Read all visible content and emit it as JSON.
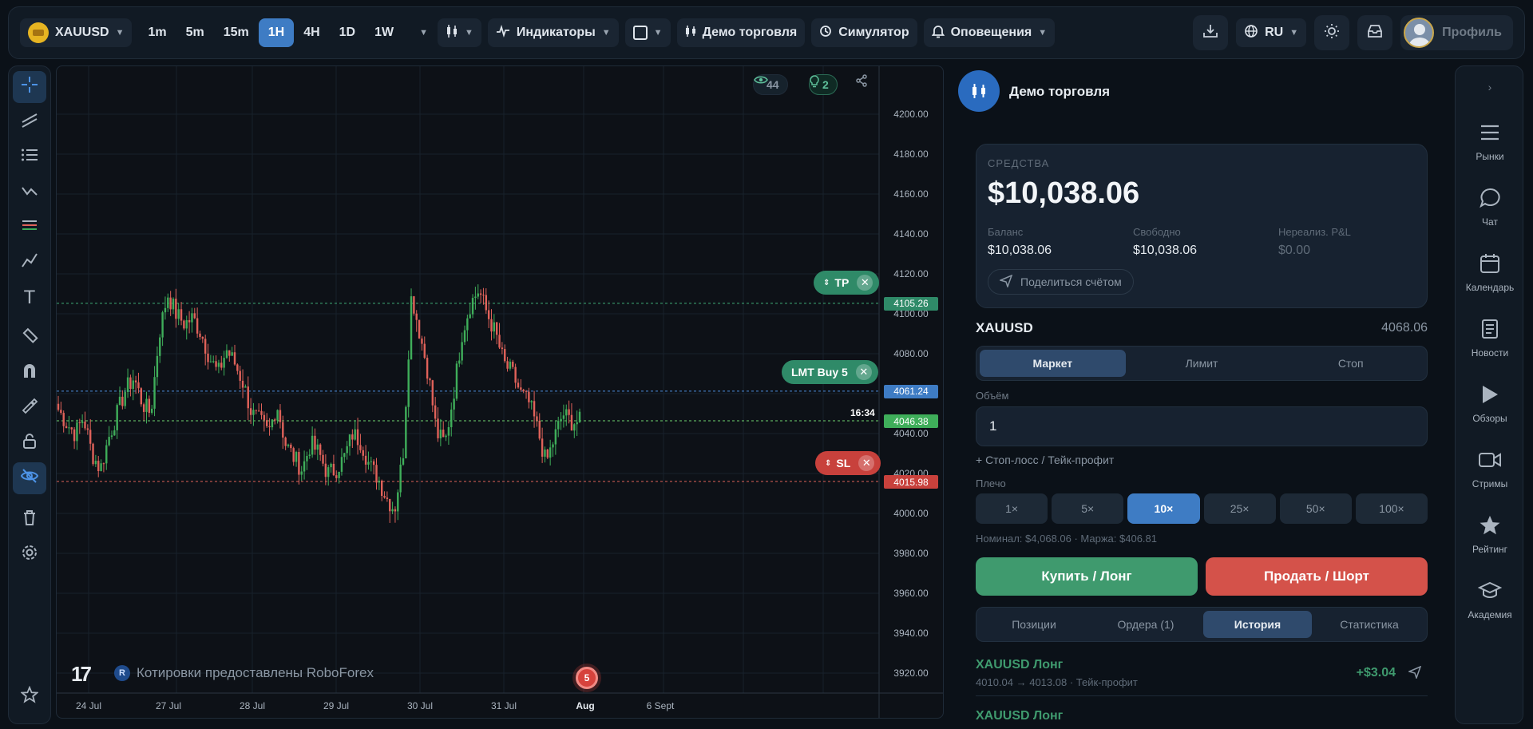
{
  "topbar": {
    "symbol": "XAUUSD",
    "timeframes": [
      "1m",
      "5m",
      "15m",
      "1H",
      "4H",
      "1D",
      "1W"
    ],
    "active_timeframe": "1H",
    "indicators_label": "Индикаторы",
    "demo_label": "Демо торговля",
    "simulator_label": "Симулятор",
    "alerts_label": "Оповещения",
    "language": "RU",
    "profile_label": "Профиль"
  },
  "chart": {
    "watchers": "44",
    "ideas": "2",
    "tp_label": "TP",
    "lmt_label": "LMT Buy 5",
    "sl_label": "SL",
    "tp_price": "4105.26",
    "lmt_price": "4061.24",
    "last_price": "4046.38",
    "sl_price": "4015.98",
    "countdown": "16:34",
    "provider": "Котировки предоставлены RoboForex",
    "provider_badge": "R",
    "events_badge": "5",
    "y_ticks": [
      "4200.00",
      "4180.00",
      "4160.00",
      "4140.00",
      "4120.00",
      "4100.00",
      "4080.00",
      "4060.00",
      "4040.00",
      "4020.00",
      "4000.00",
      "3980.00",
      "3960.00",
      "3940.00",
      "3920.00"
    ],
    "x_ticks": [
      "24 Jul",
      "27 Jul",
      "28 Jul",
      "29 Jul",
      "30 Jul",
      "31 Jul",
      "Aug",
      "6 Sept"
    ]
  },
  "chart_data": {
    "type": "candlestick",
    "symbol": "XAUUSD",
    "timeframe": "1H",
    "ylim": [
      3910,
      4210
    ],
    "x_labels": [
      "24 Jul",
      "27 Jul",
      "28 Jul",
      "29 Jul",
      "30 Jul",
      "31 Jul",
      "Aug",
      "6 Sept"
    ],
    "close_path": [
      4052,
      4045,
      4040,
      4048,
      4030,
      4022,
      4038,
      4050,
      4062,
      4068,
      4055,
      4050,
      4090,
      4110,
      4100,
      4095,
      4098,
      4090,
      4078,
      4070,
      4082,
      4075,
      4065,
      4050,
      4046,
      4040,
      4055,
      4035,
      4028,
      4022,
      4035,
      4030,
      4020,
      4022,
      4028,
      4040,
      4036,
      4024,
      4018,
      4008,
      4002,
      4030,
      4110,
      4090,
      4070,
      4040,
      4035,
      4060,
      4090,
      4105,
      4112,
      4100,
      4090,
      4075,
      4070,
      4060,
      4055,
      4042,
      4025,
      4038,
      4050,
      4046,
      4046
    ],
    "price_lines": {
      "tp": 4105.26,
      "limit_buy": 4061.24,
      "last": 4046.38,
      "sl": 4015.98
    }
  },
  "panel": {
    "title": "Демо торговля",
    "funds_label": "СРЕДСТВА",
    "funds_total": "$10,038.06",
    "balance_label": "Баланс",
    "balance_value": "$10,038.06",
    "free_label": "Свободно",
    "free_value": "$10,038.06",
    "pnl_label": "Нереализ. P&L",
    "pnl_value": "$0.00",
    "share_label": "Поделиться счётом",
    "symbol": "XAUUSD",
    "symbol_price": "4068.06",
    "order_types": [
      "Маркет",
      "Лимит",
      "Стоп"
    ],
    "volume_label": "Объём",
    "volume_value": "1",
    "sltp_label": "+ Стоп-лосс / Тейк-профит",
    "leverage_label": "Плечо",
    "leverages": [
      "1×",
      "5×",
      "10×",
      "25×",
      "50×",
      "100×"
    ],
    "nominal": "Номинал: $4,068.06 · Маржа: $406.81",
    "buy_label": "Купить / Лонг",
    "sell_label": "Продать / Шорт",
    "tabs": [
      "Позиции",
      "Ордера (1)",
      "История",
      "Статистика"
    ],
    "history": [
      {
        "title": "XAUUSD Лонг",
        "detail": "4010.04 → 4013.08 · Тейк-профит",
        "pnl": "+$3.04"
      },
      {
        "title": "XAUUSD Лонг",
        "detail": "",
        "pnl": ""
      }
    ]
  },
  "rail": {
    "items": [
      "Рынки",
      "Чат",
      "Календарь",
      "Новости",
      "Обзоры",
      "Стримы",
      "Рейтинг",
      "Академия"
    ]
  },
  "colors": {
    "accent": "#3e7cc4",
    "buy": "#3f9a6e",
    "sell": "#d4524a",
    "candle_up": "#3fae5a",
    "candle_down": "#e0625a"
  }
}
